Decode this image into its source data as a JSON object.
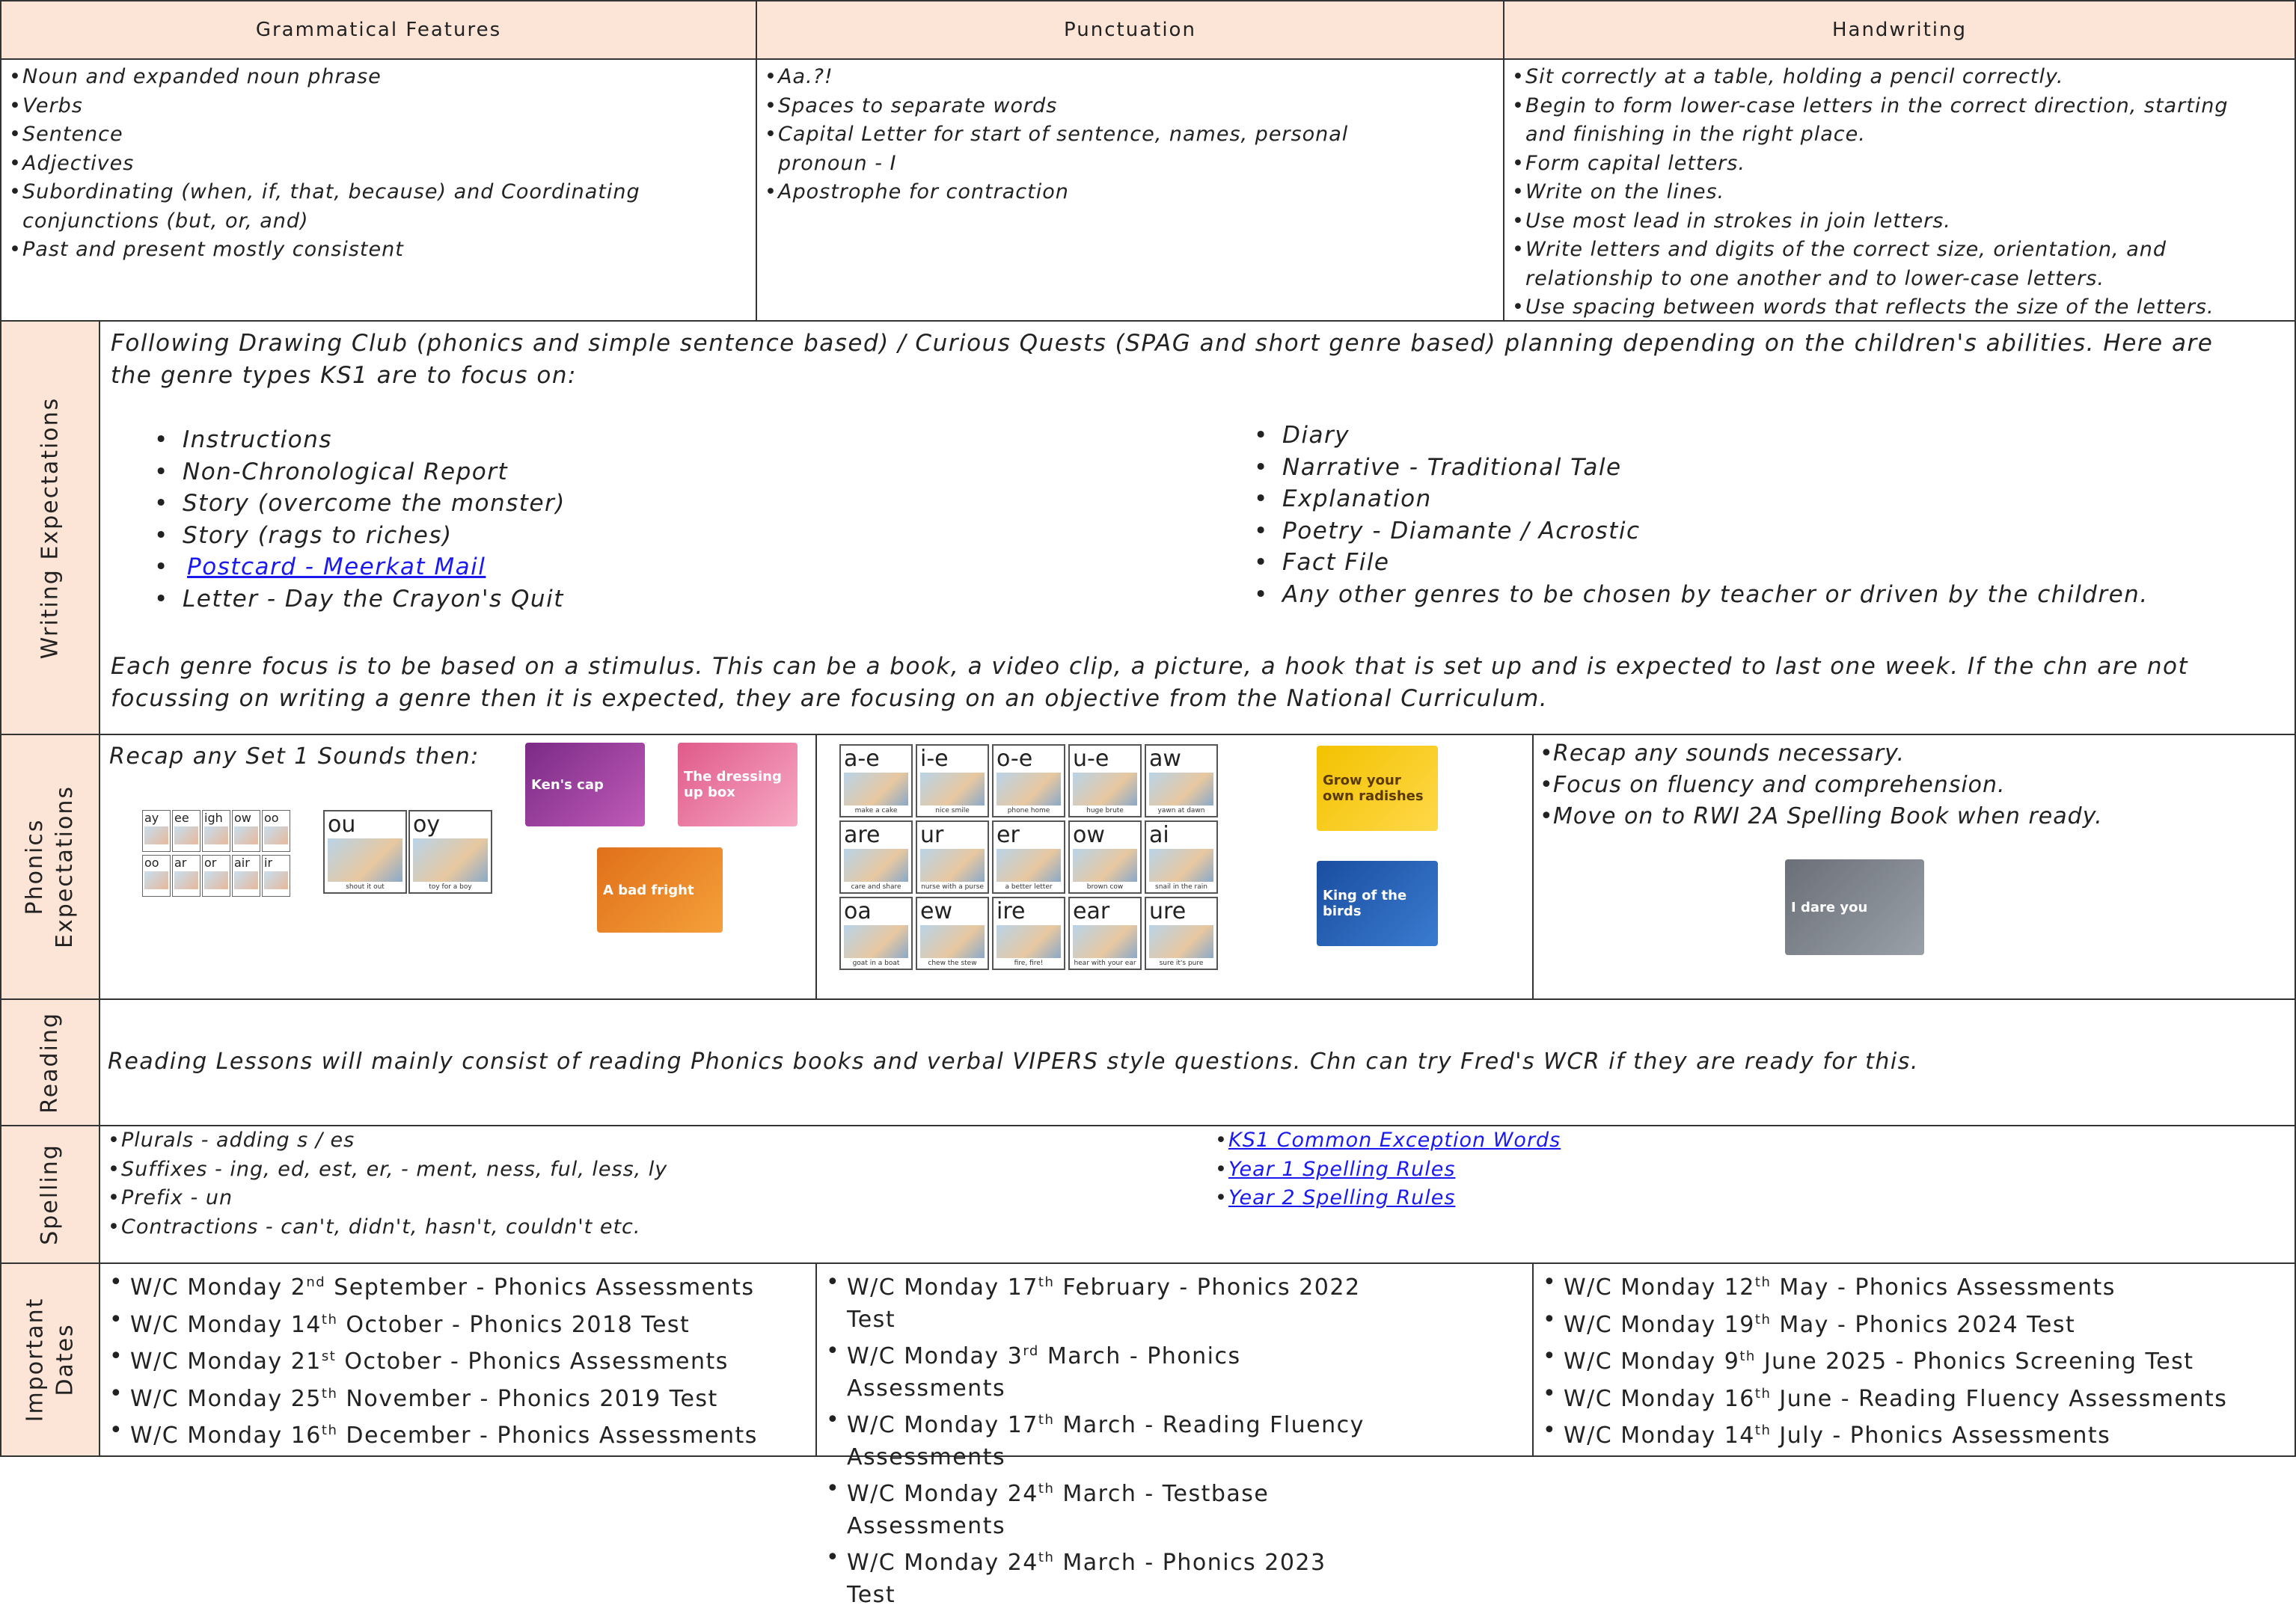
{
  "headers": {
    "grammar": "Grammatical Features",
    "punctuation": "Punctuation",
    "handwriting": "Handwriting"
  },
  "grammar_items": [
    "Noun and expanded noun phrase",
    "Verbs",
    "Sentence",
    "Adjectives",
    "Subordinating (when, if, that, because) and Coordinating conjunctions (but, or, and)",
    "Past and present mostly consistent"
  ],
  "punctuation_items": [
    "Aa.?!",
    "Spaces to separate words",
    "Capital Letter for start of sentence, names, personal pronoun - I",
    "Apostrophe for contraction"
  ],
  "handwriting_items": [
    "Sit correctly at a table, holding a pencil correctly.",
    "Begin to form lower-case letters in the correct direction, starting and finishing in the right place.",
    "Form capital letters.",
    "Write on the lines.",
    "Use most lead in strokes in join letters.",
    "Write letters and digits of the correct size, orientation, and relationship to one another and to lower-case letters.",
    "Use spacing between words that reflects the size of the letters."
  ],
  "side_labels": {
    "writing": "Writing Expectations",
    "phonics_1": "Phonics",
    "phonics_2": "Expectations",
    "reading": "Reading",
    "spelling": "Spelling",
    "dates_1": "Important",
    "dates_2": "Dates"
  },
  "writing": {
    "intro": "Following Drawing Club (phonics and simple sentence based) / Curious Quests (SPAG and short genre based) planning depending on the children's abilities. Here are the genre types KS1 are to focus on:",
    "genres_left": [
      "Instructions",
      "Non-Chronological Report",
      "Story (overcome the monster)",
      "Story (rags to riches)"
    ],
    "genre_link": "Postcard - Meerkat Mail",
    "genre_last": "Letter - Day the Crayon's Quit",
    "genres_right": [
      "Diary",
      "Narrative - Traditional Tale",
      "Explanation",
      "Poetry - Diamante / Acrostic",
      "Fact File",
      "Any other genres to be chosen by teacher or driven by the children."
    ],
    "footer": "Each genre focus is to be based on a stimulus. This can be a book, a video clip, a picture, a hook that is set up and is expected to last one week. If the chn are not focussing on writing a genre then it is expected, they are focusing on an objective from the National Curriculum."
  },
  "phonics": {
    "recap": "Recap any Set 1 Sounds then:",
    "set1_minis": [
      "ay",
      "ee",
      "igh",
      "ow",
      "oo",
      "oo",
      "ar",
      "or",
      "air",
      "ir"
    ],
    "set1_tiles": [
      {
        "sound": "ou",
        "caption": "shout it out"
      },
      {
        "sound": "oy",
        "caption": "toy for a boy"
      }
    ],
    "set2_tiles": [
      {
        "sound": "a-e",
        "caption": "make a cake"
      },
      {
        "sound": "i-e",
        "caption": "nice smile"
      },
      {
        "sound": "o-e",
        "caption": "phone home"
      },
      {
        "sound": "u-e",
        "caption": "huge brute"
      },
      {
        "sound": "aw",
        "caption": "yawn at dawn"
      },
      {
        "sound": "are",
        "caption": "care and share"
      },
      {
        "sound": "ur",
        "caption": "nurse with a purse"
      },
      {
        "sound": "er",
        "caption": "a better letter"
      },
      {
        "sound": "ow",
        "caption": "brown cow"
      },
      {
        "sound": "ai",
        "caption": "snail in the rain"
      },
      {
        "sound": "oa",
        "caption": "goat in a boat"
      },
      {
        "sound": "ew",
        "caption": "chew the stew"
      },
      {
        "sound": "ire",
        "caption": "fire, fire!"
      },
      {
        "sound": "ear",
        "caption": "hear with your ear"
      },
      {
        "sound": "ure",
        "caption": "sure it's pure"
      }
    ],
    "books": {
      "b1": "Ken's cap",
      "b2": "The dressing up box",
      "b3": "A bad fright",
      "b4": "Grow your own radishes",
      "b5": "King of the birds",
      "b6": "I dare you"
    },
    "next_items": [
      "Recap any sounds necessary.",
      "Focus on fluency and comprehension.",
      "Move on to RWI 2A Spelling Book when ready."
    ]
  },
  "reading": "Reading Lessons will mainly consist of reading Phonics books and verbal VIPERS style questions. Chn can try Fred's WCR if they are ready for this.",
  "spelling": {
    "items": [
      "Plurals - adding s / es",
      "Suffixes - ing, ed, est, er, - ment, ness, ful, less, ly",
      "Prefix - un",
      "Contractions - can't, didn't, hasn't, couldn't etc."
    ],
    "links": [
      "KS1 Common Exception Words",
      "Year 1 Spelling Rules",
      "Year 2 Spelling Rules"
    ]
  },
  "dates": {
    "col1": [
      {
        "pre": "W/C Monday 2",
        "sup": "nd",
        "post": " September - Phonics Assessments"
      },
      {
        "pre": "W/C Monday 14",
        "sup": "th",
        "post": " October - Phonics 2018 Test"
      },
      {
        "pre": "W/C Monday 21",
        "sup": "st",
        "post": " October - Phonics Assessments"
      },
      {
        "pre": "W/C Monday 25",
        "sup": "th",
        "post": " November - Phonics 2019 Test"
      },
      {
        "pre": "W/C Monday 16",
        "sup": "th",
        "post": " December - Phonics Assessments"
      }
    ],
    "col2": [
      {
        "pre": "W/C Monday 17",
        "sup": "th",
        "post": " February - Phonics 2022 Test"
      },
      {
        "pre": "W/C Monday 3",
        "sup": "rd",
        "post": " March - Phonics Assessments"
      },
      {
        "pre": "W/C Monday 17",
        "sup": "th",
        "post": " March - Reading Fluency Assessments"
      },
      {
        "pre": "W/C Monday 24",
        "sup": "th",
        "post": " March - Testbase Assessments"
      },
      {
        "pre": "W/C Monday 24",
        "sup": "th",
        "post": " March - Phonics 2023 Test"
      }
    ],
    "col3": [
      {
        "pre": "W/C Monday 12",
        "sup": "th",
        "post": " May - Phonics Assessments"
      },
      {
        "pre": "W/C Monday 19",
        "sup": "th",
        "post": "  May - Phonics 2024 Test"
      },
      {
        "pre": "W/C Monday 9",
        "sup": "th",
        "post": " June 2025 - Phonics Screening Test"
      },
      {
        "pre": "W/C Monday 16",
        "sup": "th",
        "post": " June - Reading Fluency Assessments"
      },
      {
        "pre": "W/C Monday 14",
        "sup": "th",
        "post": " July - Phonics Assessments"
      }
    ]
  },
  "colors": {
    "header_bg": "#fce4d6",
    "border": "#333333",
    "link": "#1a1aee"
  }
}
